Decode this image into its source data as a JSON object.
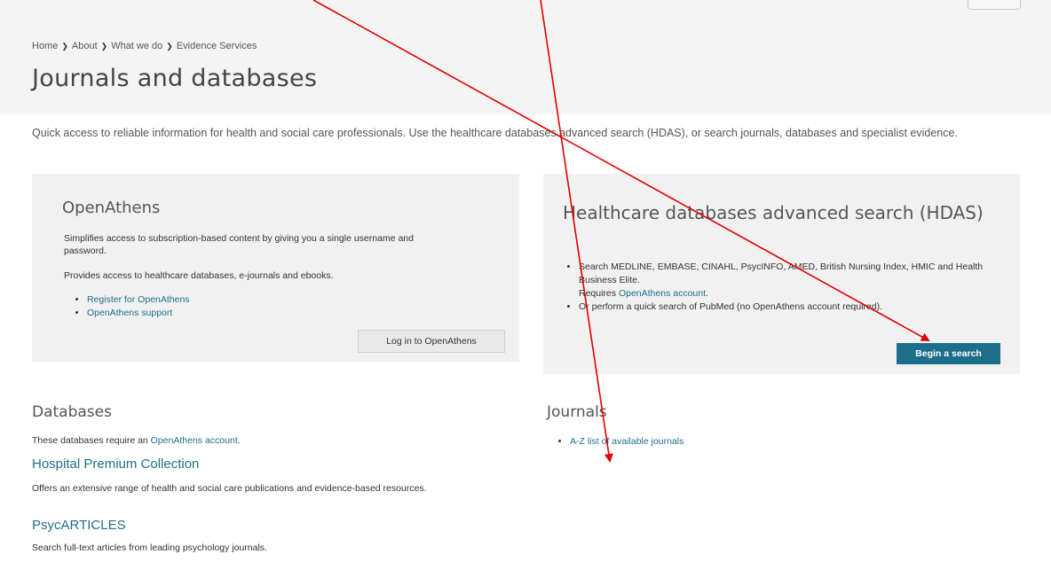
{
  "breadcrumb": {
    "items": [
      "Home",
      "About",
      "What we do",
      "Evidence Services"
    ]
  },
  "page_title": "Journals and databases",
  "intro": "Quick access to reliable information for health and social care professionals. Use the healthcare databases advanced search (HDAS), or search journals, databases and specialist evidence.",
  "openathens": {
    "title": "OpenAthens",
    "desc1": "Simplifies access to subscription-based content by giving you a single username and password.",
    "desc2": "Provides access to healthcare databases, e-journals and ebooks.",
    "links": [
      "Register for OpenAthens",
      "OpenAthens support"
    ],
    "button": "Log in to OpenAthens"
  },
  "hdas": {
    "title": "Healthcare databases advanced search (HDAS)",
    "bullet1": "Search MEDLINE, EMBASE, CINAHL, PsycINFO, AMED, British Nursing Index, HMIC and Health Business Elite.",
    "bullet1_req_prefix": "Requires ",
    "bullet1_req_link": "OpenAthens account",
    "bullet1_req_suffix": ".",
    "bullet2": "Or perform a quick search of PubMed (no OpenAthens account required).",
    "button": "Begin a search"
  },
  "databases": {
    "title": "Databases",
    "note_prefix": "These databases require an ",
    "note_link": "OpenAthens account",
    "note_suffix": ".",
    "items": [
      {
        "name": "Hospital Premium Collection",
        "desc": "Offers an extensive range of health and social care publications and evidence-based resources."
      },
      {
        "name": "PsycARTICLES",
        "desc": "Search full-text articles from leading psychology journals."
      }
    ]
  },
  "journals": {
    "title": "Journals",
    "links": [
      "A-Z list of available journals"
    ]
  },
  "colors": {
    "accent": "#1b6f8b",
    "link": "#1f6e8c",
    "annotation_arrow": "#e00000"
  }
}
